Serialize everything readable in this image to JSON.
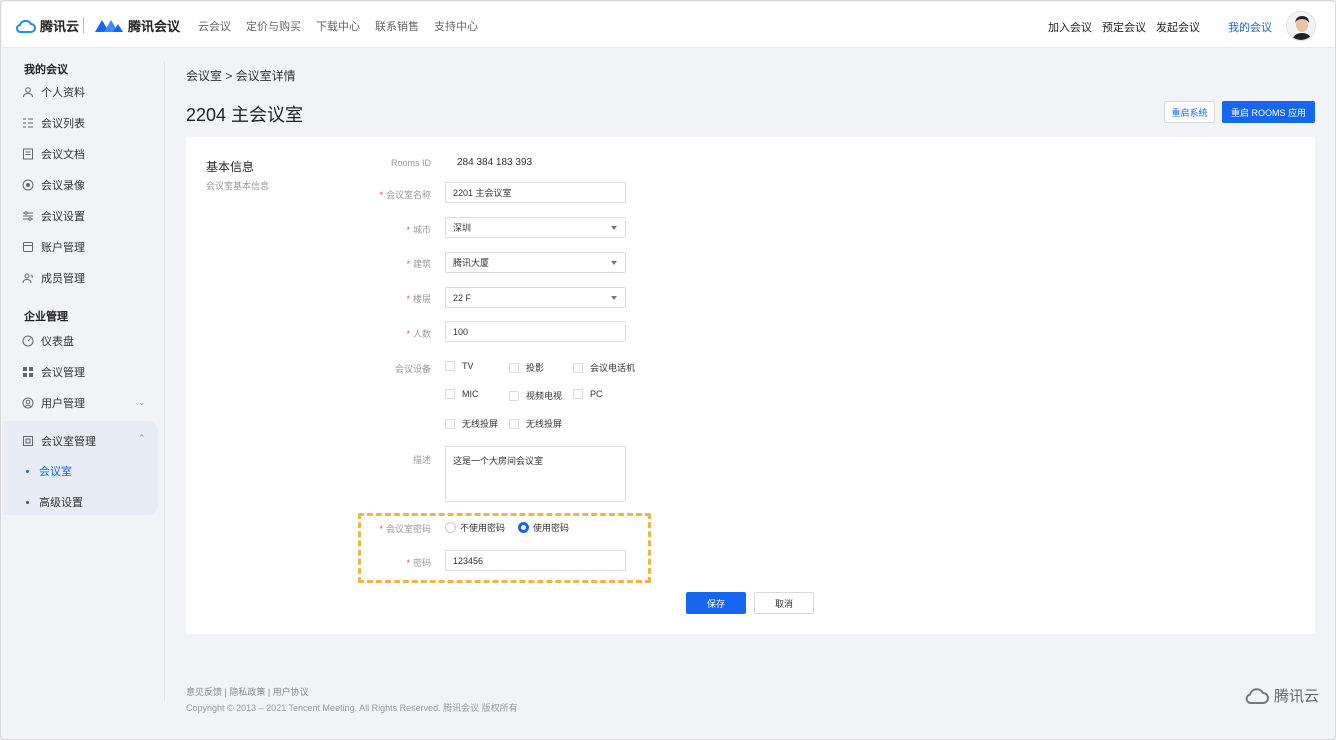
{
  "header": {
    "cloud_logo": "腾讯云",
    "meeting_logo": "腾讯会议",
    "nav": [
      "云会议",
      "定价与购买",
      "下载中心",
      "联系销售",
      "支持中心"
    ],
    "actions": [
      "加入会议",
      "预定会议",
      "发起会议"
    ],
    "my_meeting": "我的会议"
  },
  "sidebar": {
    "section1": "我的会议",
    "items1": [
      "个人资料",
      "会议列表",
      "会议文档",
      "会议录像",
      "会议设置",
      "账户管理",
      "成员管理"
    ],
    "section2": "企业管理",
    "items2": [
      "仪表盘",
      "会议管理",
      "用户管理",
      "会议室管理"
    ],
    "sub": [
      "会议室",
      "高级设置"
    ]
  },
  "breadcrumb": "会议室 > 会议室详情",
  "page_title": "2204 主会议室",
  "buttons": {
    "restart_system": "重启系统",
    "restart_rooms": "重启 ROOMS 应用",
    "save": "保存",
    "cancel": "取消"
  },
  "section": {
    "title": "基本信息",
    "subtitle": "会议室基本信息"
  },
  "form": {
    "rooms_id_label": "Rooms ID",
    "rooms_id": "284 384 183 393",
    "name_label": "会议室名称",
    "name": "2201 主会议室",
    "city_label": "城市",
    "city": "深圳",
    "building_label": "建筑",
    "building": "腾讯大厦",
    "floor_label": "楼层",
    "floor": "22 F",
    "people_label": "人数",
    "people": "100",
    "devices_label": "会议设备",
    "devices": [
      "TV",
      "投影",
      "会议电话机",
      "MIC",
      "视频电视",
      "PC",
      "无线投屏",
      "无线投屏"
    ],
    "desc_label": "描述",
    "desc": "这是一个大房间会议室",
    "pwd_mode_label": "会议室密码",
    "pwd_options": [
      "不使用密码",
      "使用密码"
    ],
    "pwd_selected": "使用密码",
    "pwd_label": "密码",
    "pwd": "123456"
  },
  "footer": {
    "links": "意见反馈 | 隐私政策 | 用户协议",
    "copyright": "Copyright © 2013 – 2021 Tencent Meeting. All Rights Reserved. 腾讯会议 版权所有",
    "logo": "腾讯云"
  },
  "colors": {
    "accent": "#1766f0",
    "highlight": "#f2b34b",
    "required": "#e34d59"
  }
}
